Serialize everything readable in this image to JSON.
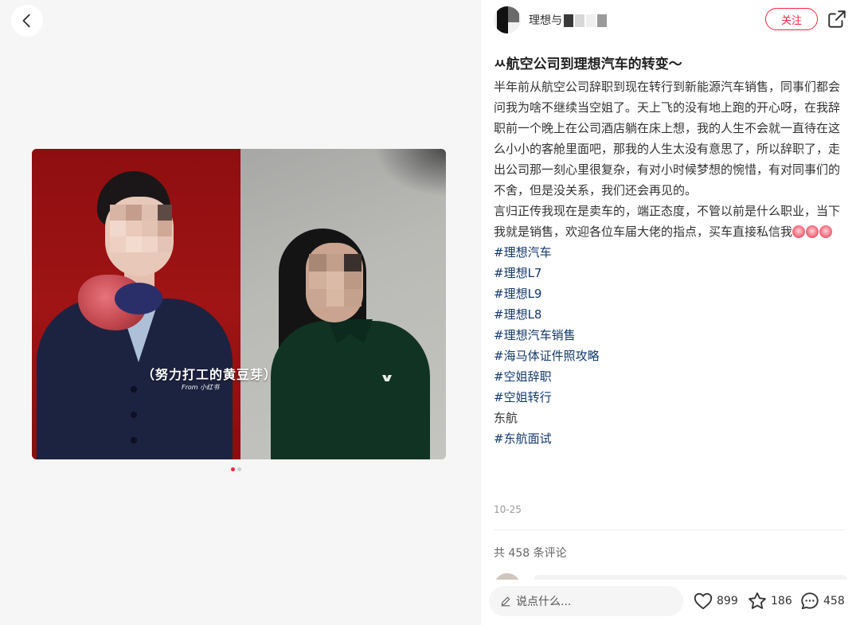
{
  "nav": {
    "back_icon": "chevron-left-icon"
  },
  "image": {
    "caption": "（努力打工的黄豆芽）",
    "caption_sub": "From 小红书",
    "carousel": {
      "count": 2,
      "active": 1
    }
  },
  "post": {
    "author_name": "理想与",
    "follow_label": "关注",
    "share_icon": "share-icon",
    "title": "ㅆ航空公司到理想汽车的转变～",
    "paragraphs": [
      "半年前从航空公司辞职到现在转行到新能源汽车销售，同事们都会问我为啥不继续当空姐了。天上飞的没有地上跑的开心呀，在我辞职前一个晚上在公司酒店躺在床上想，我的人生不会就一直待在这么小小的客舱里面吧，那我的人生太没有意思了，所以辞职了，走出公司那一刻心里很复杂，有对小时候梦想的惋惜，有对同事们的不舍，但是没关系，我们还会再见的。",
      "言归正传我现在是卖车的，端正态度，不管以前是什么职业，当下我就是销售，欢迎各位车届大佬的指点，买车直接私信我"
    ],
    "tags": [
      {
        "text": "#理想汽车",
        "is_tag": true
      },
      {
        "text": "#理想L7",
        "is_tag": true
      },
      {
        "text": "#理想L9",
        "is_tag": true
      },
      {
        "text": "#理想L8",
        "is_tag": true
      },
      {
        "text": "#理想汽车销售",
        "is_tag": true
      },
      {
        "text": "#海马体证件照攻略",
        "is_tag": true
      },
      {
        "text": "#空姐辞职",
        "is_tag": true
      },
      {
        "text": "#空姐转行",
        "is_tag": true
      },
      {
        "text": "东航",
        "is_tag": false
      },
      {
        "text": "#东航面试",
        "is_tag": true
      }
    ],
    "date": "10-25",
    "comment_count_text": "共 458 条评论"
  },
  "bottom_bar": {
    "comment_placeholder": "说点什么...",
    "likes": "899",
    "collects": "186",
    "comments": "458"
  },
  "colors": {
    "accent": "#ff2442",
    "tag": "#13386c",
    "left_bg": "#f6f6f6"
  }
}
